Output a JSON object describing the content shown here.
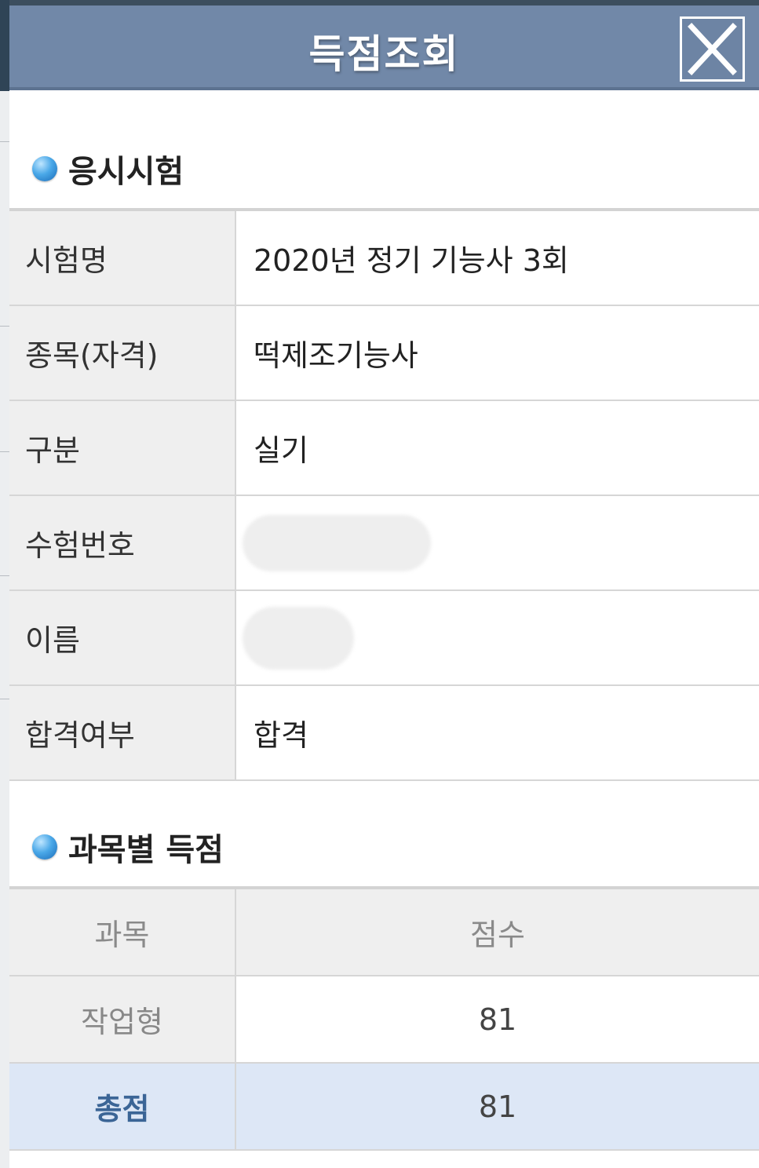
{
  "dialog": {
    "title": "득점조회",
    "close_icon": "close-icon"
  },
  "exam_section": {
    "title": "응시시험",
    "rows": [
      {
        "label": "시험명",
        "value": "2020년 정기 기능사 3회"
      },
      {
        "label": "종목(자격)",
        "value": "떡제조기능사"
      },
      {
        "label": "구분",
        "value": "실기"
      },
      {
        "label": "수험번호",
        "value": ""
      },
      {
        "label": "이름",
        "value": ""
      },
      {
        "label": "합격여부",
        "value": "합격"
      }
    ]
  },
  "score_section": {
    "title": "과목별 득점",
    "header": {
      "subject": "과목",
      "score": "점수"
    },
    "rows": [
      {
        "subject": "작업형",
        "score": "81"
      }
    ],
    "total": {
      "label": "총점",
      "score": "81"
    }
  },
  "colors": {
    "titlebar": "#7188a8",
    "total_row": "#dde7f6",
    "total_label": "#3b6596"
  }
}
